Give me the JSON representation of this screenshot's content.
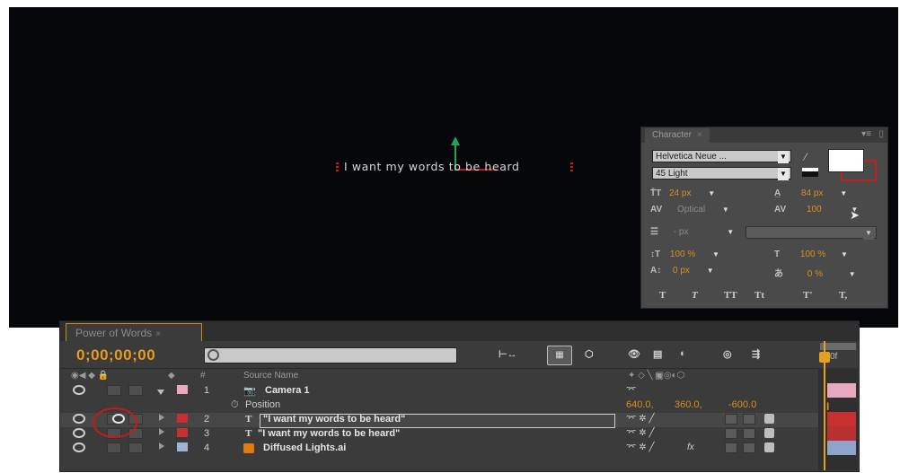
{
  "composition": {
    "text": "I want my words to be heard"
  },
  "character_panel": {
    "title": "Character",
    "font_family": "Helvetica Neue ...",
    "font_style": "45 Light",
    "font_size": "24 px",
    "leading": "84 px",
    "kerning": "Optical",
    "tracking": "100",
    "stroke_width": "- px",
    "vertical_scale": "100 %",
    "horizontal_scale": "100 %",
    "baseline_shift": "0 px",
    "tsume": "0 %",
    "format_buttons": [
      "T",
      "T",
      "TT",
      "Tt",
      "T'",
      "T,"
    ]
  },
  "timeline": {
    "tab_title": "Power of Words",
    "timecode": "0;00;00;00",
    "search_placeholder": "",
    "header": {
      "source_name": "Source Name",
      "hash": "#",
      "switches": "fx"
    },
    "layers": [
      {
        "number": "1",
        "name": "Camera 1",
        "label_color": "#e8a8c0",
        "expanded": true
      },
      {
        "number": "2",
        "name": "\"I want my words to be heard\"",
        "label_color": "#c83030",
        "selected": true
      },
      {
        "number": "3",
        "name": "\"I want my words to be heard\"",
        "label_color": "#c83030"
      },
      {
        "number": "4",
        "name": "Diffused Lights.ai",
        "label_color": "#a0b4d8"
      }
    ],
    "property": {
      "name": "Position",
      "value_x": "640.0,",
      "value_y": "360.0,",
      "value_z": "-600.0"
    },
    "time_ruler_label": "0f",
    "fx_label": "fx"
  }
}
